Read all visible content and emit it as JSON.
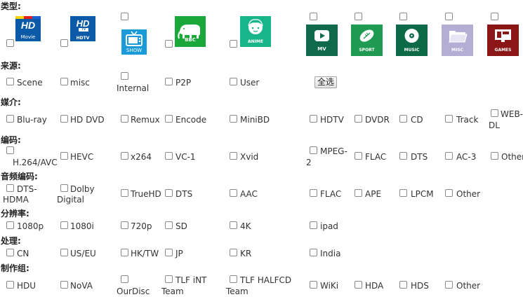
{
  "sections": {
    "type": "类型:",
    "source": "来源:",
    "medium": "媒介:",
    "codec": "编码:",
    "audio": "音频编码:",
    "resolution": "分辨率:",
    "processing": "处理:",
    "group": "制作组:"
  },
  "categories": [
    {
      "caption": "Movie",
      "icon": "hd-movie-icon",
      "color": "#0a5aa8"
    },
    {
      "caption": "HDTV",
      "icon": "hdtv-icon",
      "color": "#0a5aa8"
    },
    {
      "caption": "SHOW",
      "icon": "tv-show-icon",
      "color": "#1a9ad8"
    },
    {
      "caption": "BBC",
      "icon": "elephant-icon",
      "color": "#1aa83a"
    },
    {
      "caption": "ANIME",
      "icon": "anime-face-icon",
      "color": "#19b58a"
    },
    {
      "caption": "MV",
      "icon": "play-icon",
      "color": "#0e6a4a"
    },
    {
      "caption": "SPORT",
      "icon": "football-icon",
      "color": "#1e9a52"
    },
    {
      "caption": "MUSIC",
      "icon": "disc-icon",
      "color": "#0d6a48"
    },
    {
      "caption": "MISC",
      "icon": "folder-icon",
      "color": "#b4aed4"
    },
    {
      "caption": "GAMES",
      "icon": "game-icon",
      "color": "#8a1616"
    }
  ],
  "source": {
    "items": [
      "Scene",
      "misc",
      "Internal",
      "P2P",
      "User"
    ],
    "select_all": "全选"
  },
  "medium": [
    "Blu-ray",
    "HD DVD",
    "Remux",
    "Encode",
    "MiniBD",
    "HDTV",
    "DVDR",
    "CD",
    "Track",
    "WEB-",
    "DL"
  ],
  "codec": [
    "H.264/AVC",
    "HEVC",
    "x264",
    "VC-1",
    "Xvid",
    "MPEG-",
    "2",
    "FLAC",
    "DTS",
    "AC-3",
    "Other"
  ],
  "audio": [
    "DTS-",
    "HDMA",
    "Dolby",
    "Digital",
    "TrueHD",
    "DTS",
    "AAC",
    "FLAC",
    "APE",
    "LPCM",
    "Other"
  ],
  "resolution": [
    "1080p",
    "1080i",
    "720p",
    "SD",
    "4K",
    "ipad"
  ],
  "processing": [
    "CN",
    "US/EU",
    "HK/TW",
    "JP",
    "KR",
    "India"
  ],
  "group": [
    "HDU",
    "NoVA",
    "OurDisc",
    "TLF iNT",
    "Team",
    "TLF HALFCD",
    "Team",
    "WiKi",
    "HDA",
    "HDS",
    "Other"
  ]
}
